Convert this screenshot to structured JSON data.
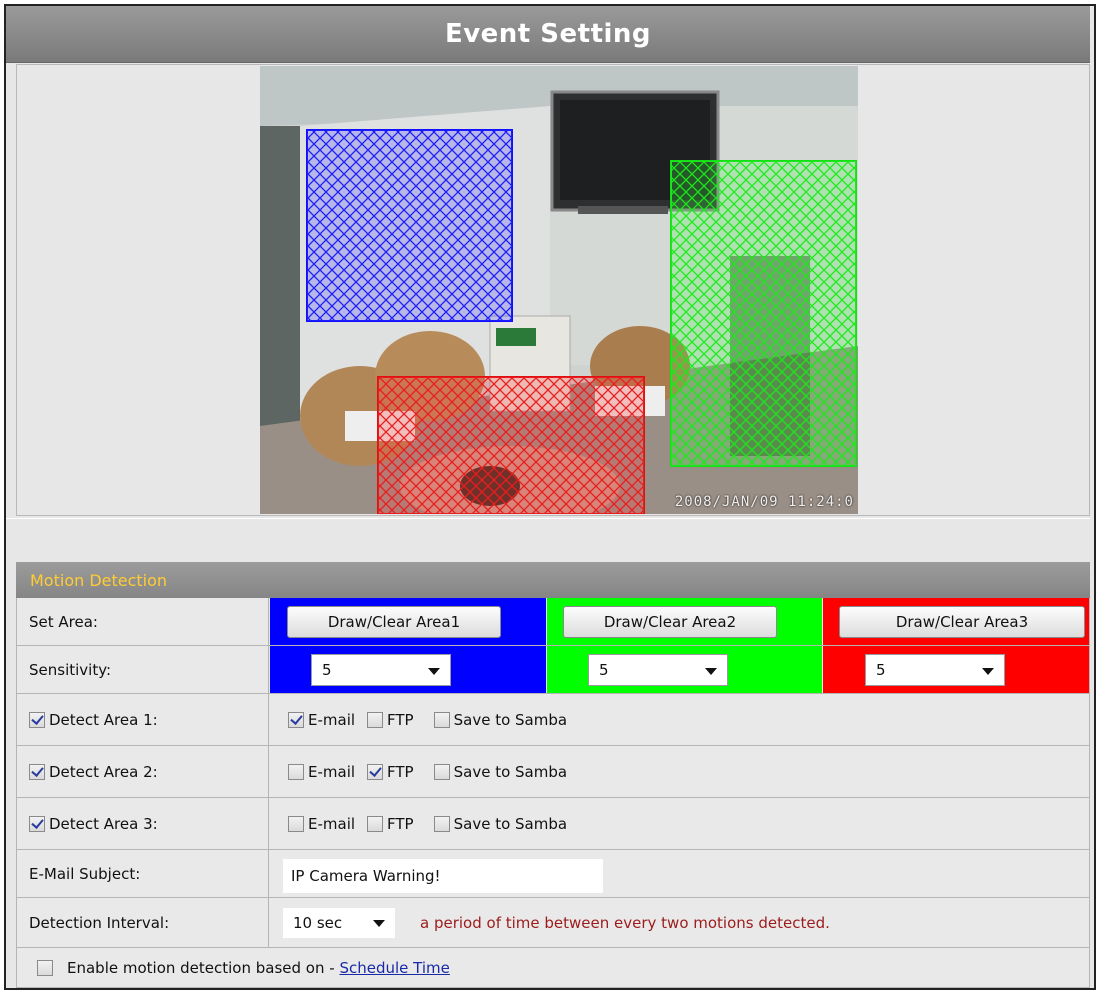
{
  "title": "Event Setting",
  "camera": {
    "timestamp": "2008/JAN/09 11:24:0"
  },
  "section": {
    "title": "Motion Detection"
  },
  "set_area": {
    "label": "Set Area:",
    "buttons": [
      "Draw/Clear Area1",
      "Draw/Clear Area2",
      "Draw/Clear Area3"
    ]
  },
  "sensitivity": {
    "label": "Sensitivity:",
    "values": [
      "5",
      "5",
      "5"
    ]
  },
  "detect": [
    {
      "label": "Detect Area 1:",
      "enabled": true,
      "email": true,
      "ftp": false,
      "samba": false
    },
    {
      "label": "Detect Area 2:",
      "enabled": true,
      "email": false,
      "ftp": true,
      "samba": false
    },
    {
      "label": "Detect Area 3:",
      "enabled": true,
      "email": false,
      "ftp": false,
      "samba": false
    }
  ],
  "options": {
    "email": "E-mail",
    "ftp": "FTP",
    "samba": "Save to Samba"
  },
  "email_subject": {
    "label": "E-Mail Subject:",
    "value": "IP Camera Warning!"
  },
  "interval": {
    "label": "Detection Interval:",
    "value": "10 sec",
    "hint": "a period of time between every two motions detected."
  },
  "schedule": {
    "checked": false,
    "label": "Enable motion detection based on - ",
    "link": "Schedule Time"
  },
  "colors": {
    "area1": "#0000ff",
    "area2": "#00ff00",
    "area3": "#ff0000",
    "section_title": "#ffcc33"
  }
}
